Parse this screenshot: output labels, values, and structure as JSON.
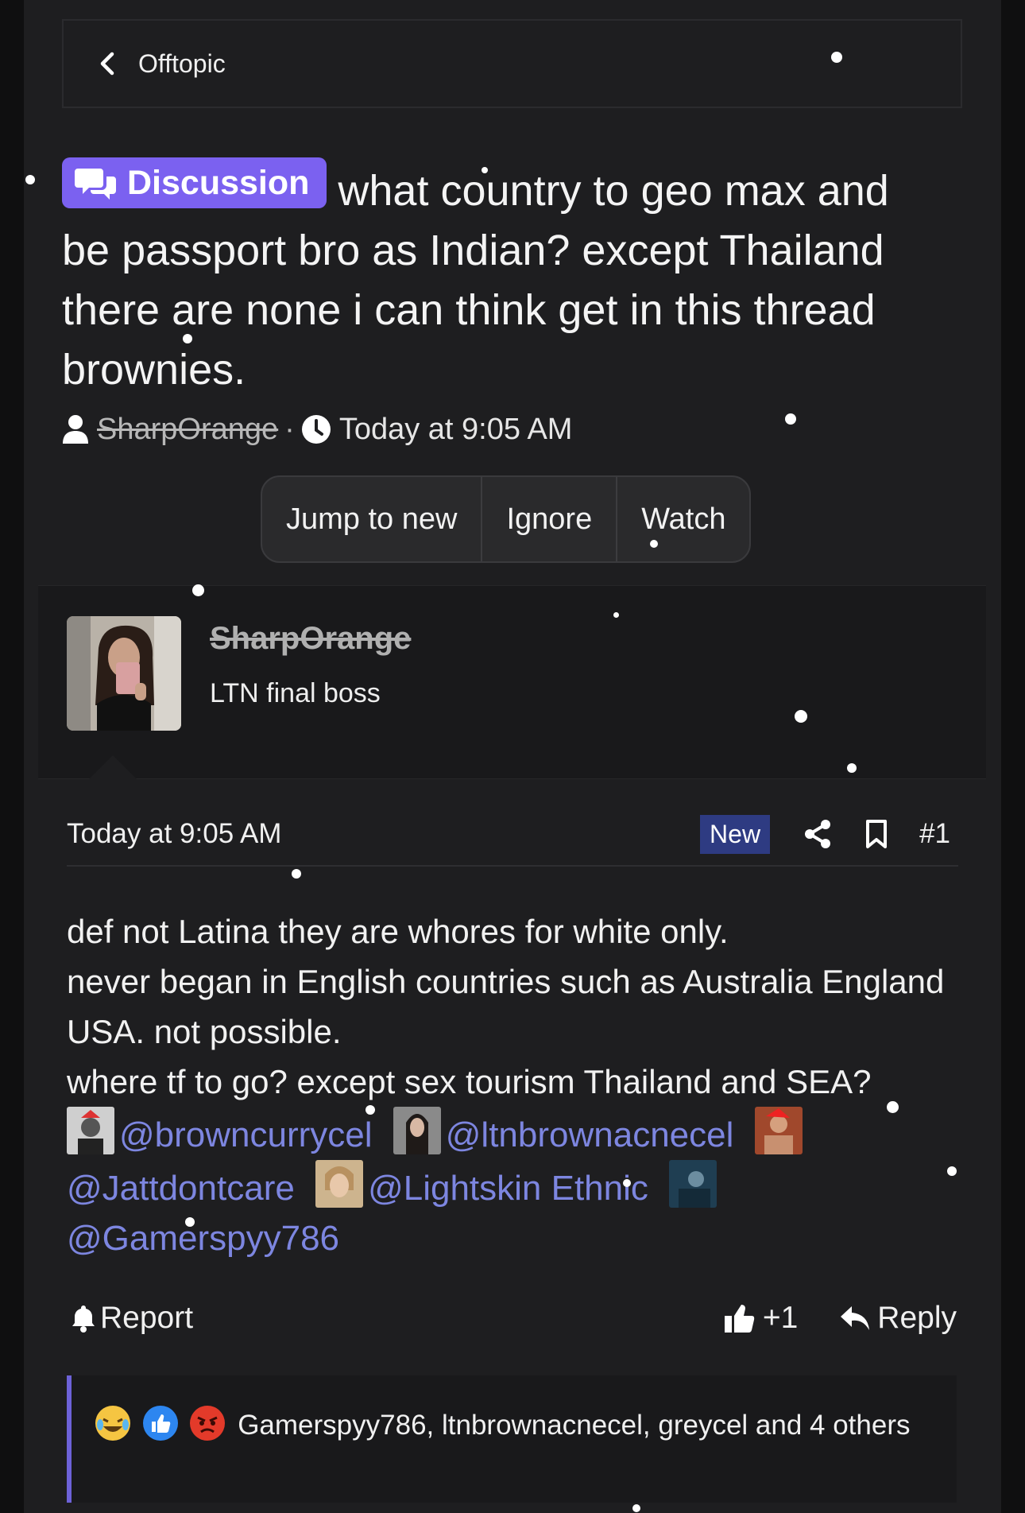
{
  "breadcrumb": {
    "label": "Offtopic",
    "icon": "chevron-left-icon"
  },
  "thread": {
    "prefix": "Discussion",
    "title": "what country to geo max and be passport bro as Indian? except Thailand there are none i can think get in this thread brownies.",
    "author": "SharpOrange",
    "separator": "·",
    "time": "Today at 9:05 AM"
  },
  "buttons": {
    "jump": "Jump to new",
    "ignore": "Ignore",
    "watch": "Watch"
  },
  "user": {
    "name": "SharpOrange",
    "title": "LTN final boss"
  },
  "post": {
    "date": "Today at 9:05 AM",
    "new_label": "New",
    "number": "#1",
    "lines": [
      "def not Latina they are whores for white only.",
      "never began in English countries such as Australia England USA. not possible.",
      "where tf to go? except sex tourism Thailand and SEA?"
    ],
    "mentions": [
      "@browncurrycel",
      "@ltnbrownacnecel",
      "@Jattdontcare",
      "@Lightskin Ethnic",
      "@Gamerspyy786"
    ]
  },
  "actions": {
    "report": "Report",
    "like": "+1",
    "reply": "Reply"
  },
  "reactions": {
    "text": "Gamerspyy786, ltnbrownacnecel, greycel and 4 others"
  },
  "colors": {
    "accent": "#7b61f0",
    "link": "#7d86e0",
    "new_badge": "#2e3b82",
    "background": "#1e1e20"
  }
}
